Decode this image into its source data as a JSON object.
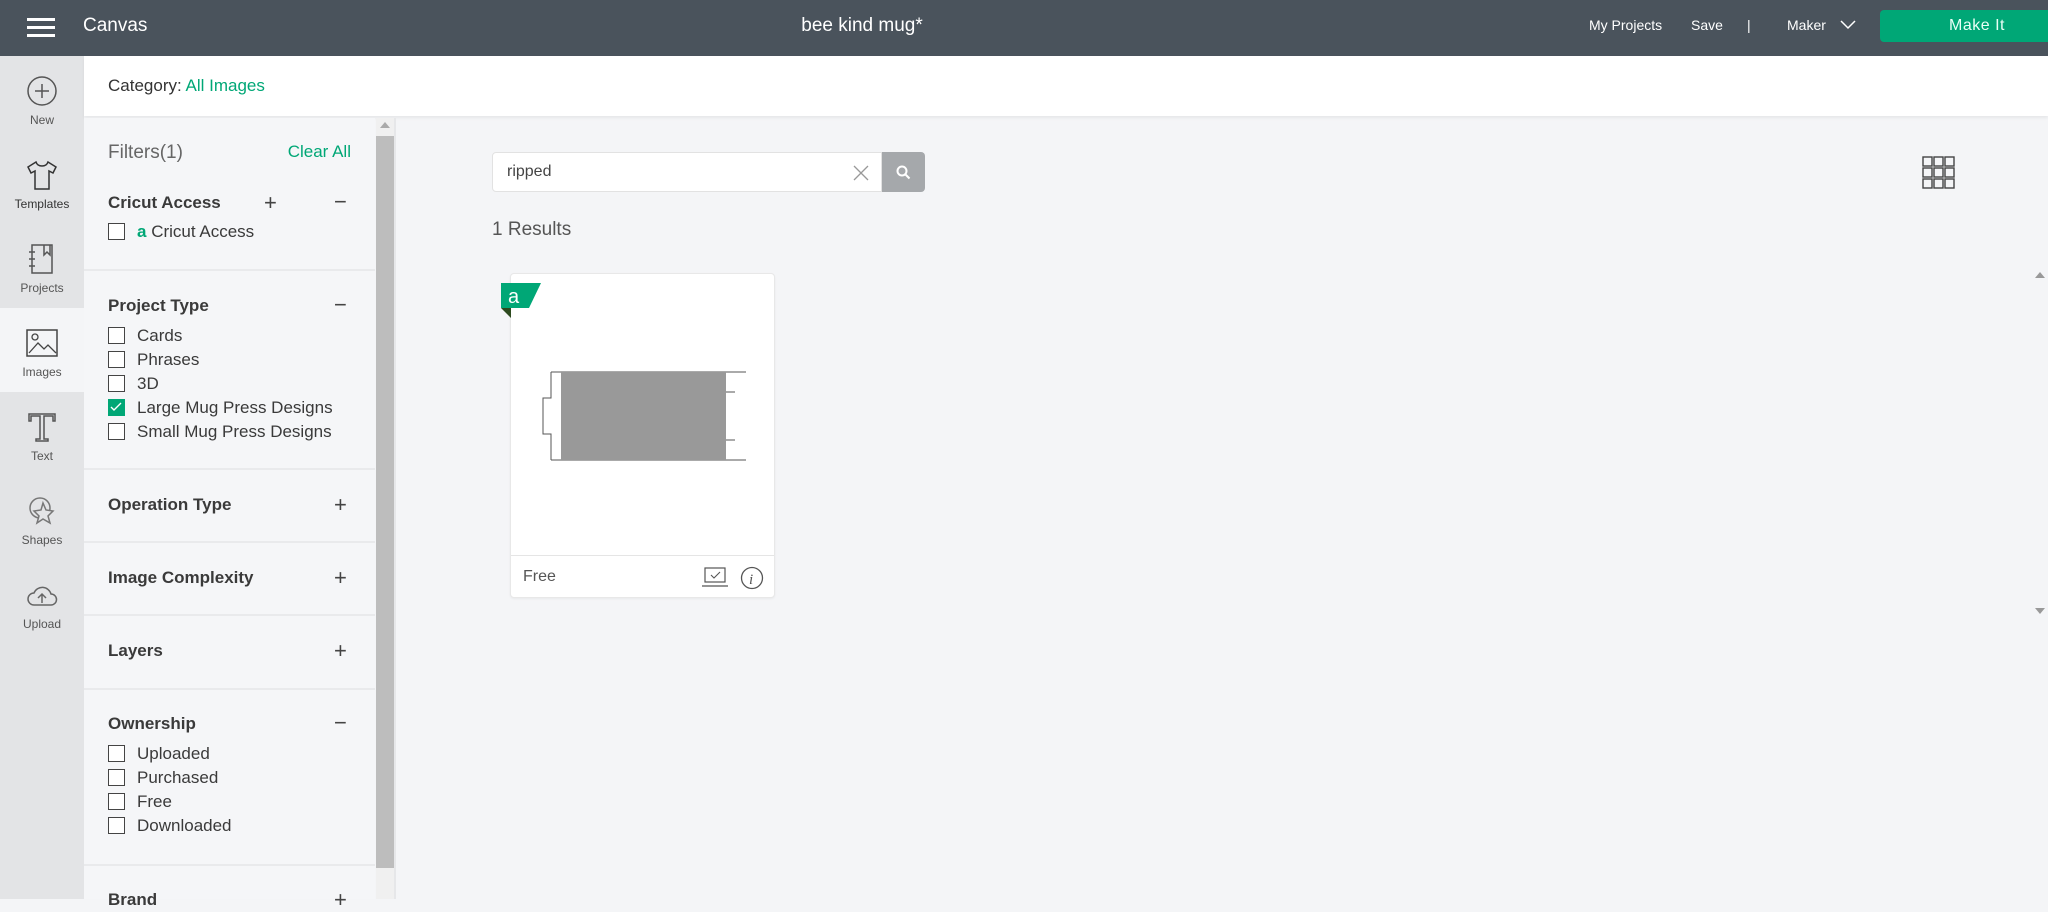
{
  "header": {
    "app": "Canvas",
    "project_title": "bee kind mug*",
    "my_projects": "My Projects",
    "save": "Save",
    "separator": "|",
    "machine": "Maker",
    "make_it": "Make It"
  },
  "nav": [
    {
      "label": "New",
      "icon": "plus-circle-icon"
    },
    {
      "label": "Templates",
      "icon": "tshirt-icon"
    },
    {
      "label": "Projects",
      "icon": "notebook-icon"
    },
    {
      "label": "Images",
      "icon": "image-icon",
      "active": true
    },
    {
      "label": "Text",
      "icon": "text-icon"
    },
    {
      "label": "Shapes",
      "icon": "shapes-icon"
    },
    {
      "label": "Upload",
      "icon": "upload-cloud-icon"
    }
  ],
  "category": {
    "label": "Category:",
    "value": "All Images"
  },
  "filters": {
    "title": "Filters(1)",
    "clear_all": "Clear All",
    "cricut_access": {
      "title": "Cricut Access",
      "items": [
        {
          "label": "Cricut Access",
          "checked": false
        }
      ]
    },
    "project_type": {
      "title": "Project Type",
      "items": [
        {
          "label": "Cards",
          "checked": false
        },
        {
          "label": "Phrases",
          "checked": false
        },
        {
          "label": "3D",
          "checked": false
        },
        {
          "label": "Large Mug Press Designs",
          "checked": true
        },
        {
          "label": "Small Mug Press Designs",
          "checked": false
        }
      ]
    },
    "operation_type": {
      "title": "Operation Type"
    },
    "image_complexity": {
      "title": "Image Complexity"
    },
    "layers": {
      "title": "Layers"
    },
    "ownership": {
      "title": "Ownership",
      "items": [
        {
          "label": "Uploaded",
          "checked": false
        },
        {
          "label": "Purchased",
          "checked": false
        },
        {
          "label": "Free",
          "checked": false
        },
        {
          "label": "Downloaded",
          "checked": false
        }
      ]
    },
    "brand": {
      "title": "Brand"
    }
  },
  "search": {
    "value": "ripped"
  },
  "results": {
    "count_text": "1 Results",
    "cards": [
      {
        "price": "Free",
        "badge": "a"
      }
    ]
  },
  "colors": {
    "accent": "#00a776",
    "header": "#4a535c"
  }
}
